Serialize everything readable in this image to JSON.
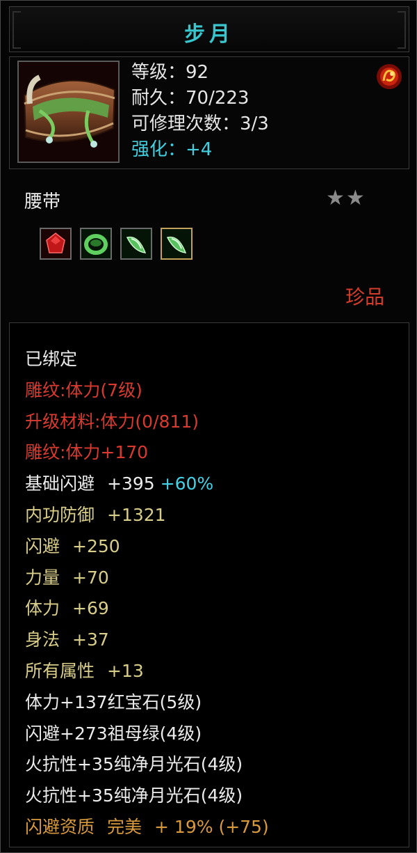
{
  "title": "步月",
  "stats": {
    "level": "等级：92",
    "durability": "耐久：70/223",
    "repairs": "可修理次数：3/3",
    "enhance": "强化：+4"
  },
  "slot_name": "腰带",
  "stars": "★★",
  "quality": "珍品",
  "attributes": {
    "bound": "已绑定",
    "engrave_level": "雕纹:体力(7级)",
    "upgrade_material": "升级材料:体力(0/811)",
    "engrave_bonus": "雕纹:体力+170",
    "base_dodge_label": "基础闪避",
    "base_dodge_value": "+395",
    "base_dodge_pct": "+60%",
    "rows": [
      {
        "label": "内功防御",
        "value": "+1321"
      },
      {
        "label": "闪避",
        "value": "+250"
      },
      {
        "label": "力量",
        "value": "+70"
      },
      {
        "label": "体力",
        "value": "+69"
      },
      {
        "label": "身法",
        "value": "+37"
      },
      {
        "label": "所有属性",
        "value": "+13"
      }
    ],
    "gems": [
      "体力+137红宝石(5级)",
      "闪避+273祖母绿(4级)",
      "火抗性+35纯净月光石(4级)",
      "火抗性+35纯净月光石(4级)"
    ],
    "aptitude_label": "闪避资质",
    "aptitude_rating": "完美",
    "aptitude_value": "+ 19% (+75)"
  },
  "colors": {
    "title": "#39c7cf",
    "red": "#d83a30",
    "yellow": "#d9cd8a",
    "cyan": "#43d2e6",
    "orange": "#d89a3c"
  },
  "icons": [
    "belt-item-icon",
    "fire-emblem-icon",
    "ruby-gem-icon",
    "emerald-gem-icon",
    "moonstone-gem-icon"
  ]
}
